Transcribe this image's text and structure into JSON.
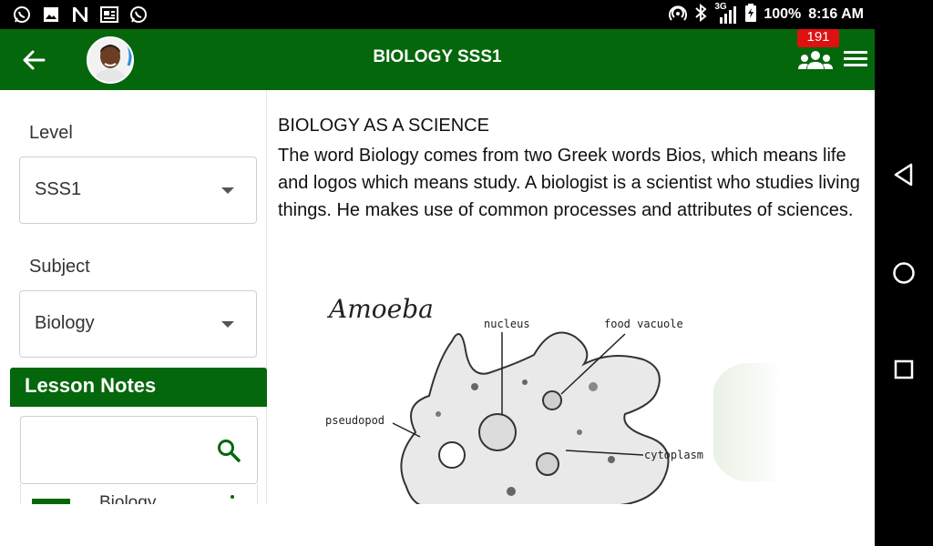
{
  "status_bar": {
    "battery": "100%",
    "time": "8:16 AM",
    "network": "3G",
    "left_icons": [
      "whatsapp-icon",
      "gallery-icon",
      "n-app-icon",
      "news-icon",
      "whatsapp-icon"
    ]
  },
  "app_bar": {
    "title": "BIOLOGY SSS1",
    "badge_count": "191",
    "color": "#05670b"
  },
  "sidebar": {
    "level_label": "Level",
    "level_value": "SSS1",
    "subject_label": "Subject",
    "subject_value": "Biology",
    "lesson_notes_header": "Lesson Notes",
    "search_placeholder": "",
    "list_items": [
      {
        "title": "Biology"
      }
    ]
  },
  "content": {
    "heading": "BIOLOGY AS A SCIENCE",
    "body": "The word Biology comes from two Greek words Bios, which means life and logos which means study. A biologist is a scientist who studies living things. He makes use of common processes and attributes of sciences.",
    "diagram": {
      "title": "Amoeba",
      "labels": {
        "nucleus": "nucleus",
        "food_vacuole": "food vacuole",
        "pseudopod": "pseudopod",
        "cytoplasm": "cytoplasm"
      }
    }
  },
  "colors": {
    "accent": "#05670b",
    "badge": "#e01010"
  }
}
